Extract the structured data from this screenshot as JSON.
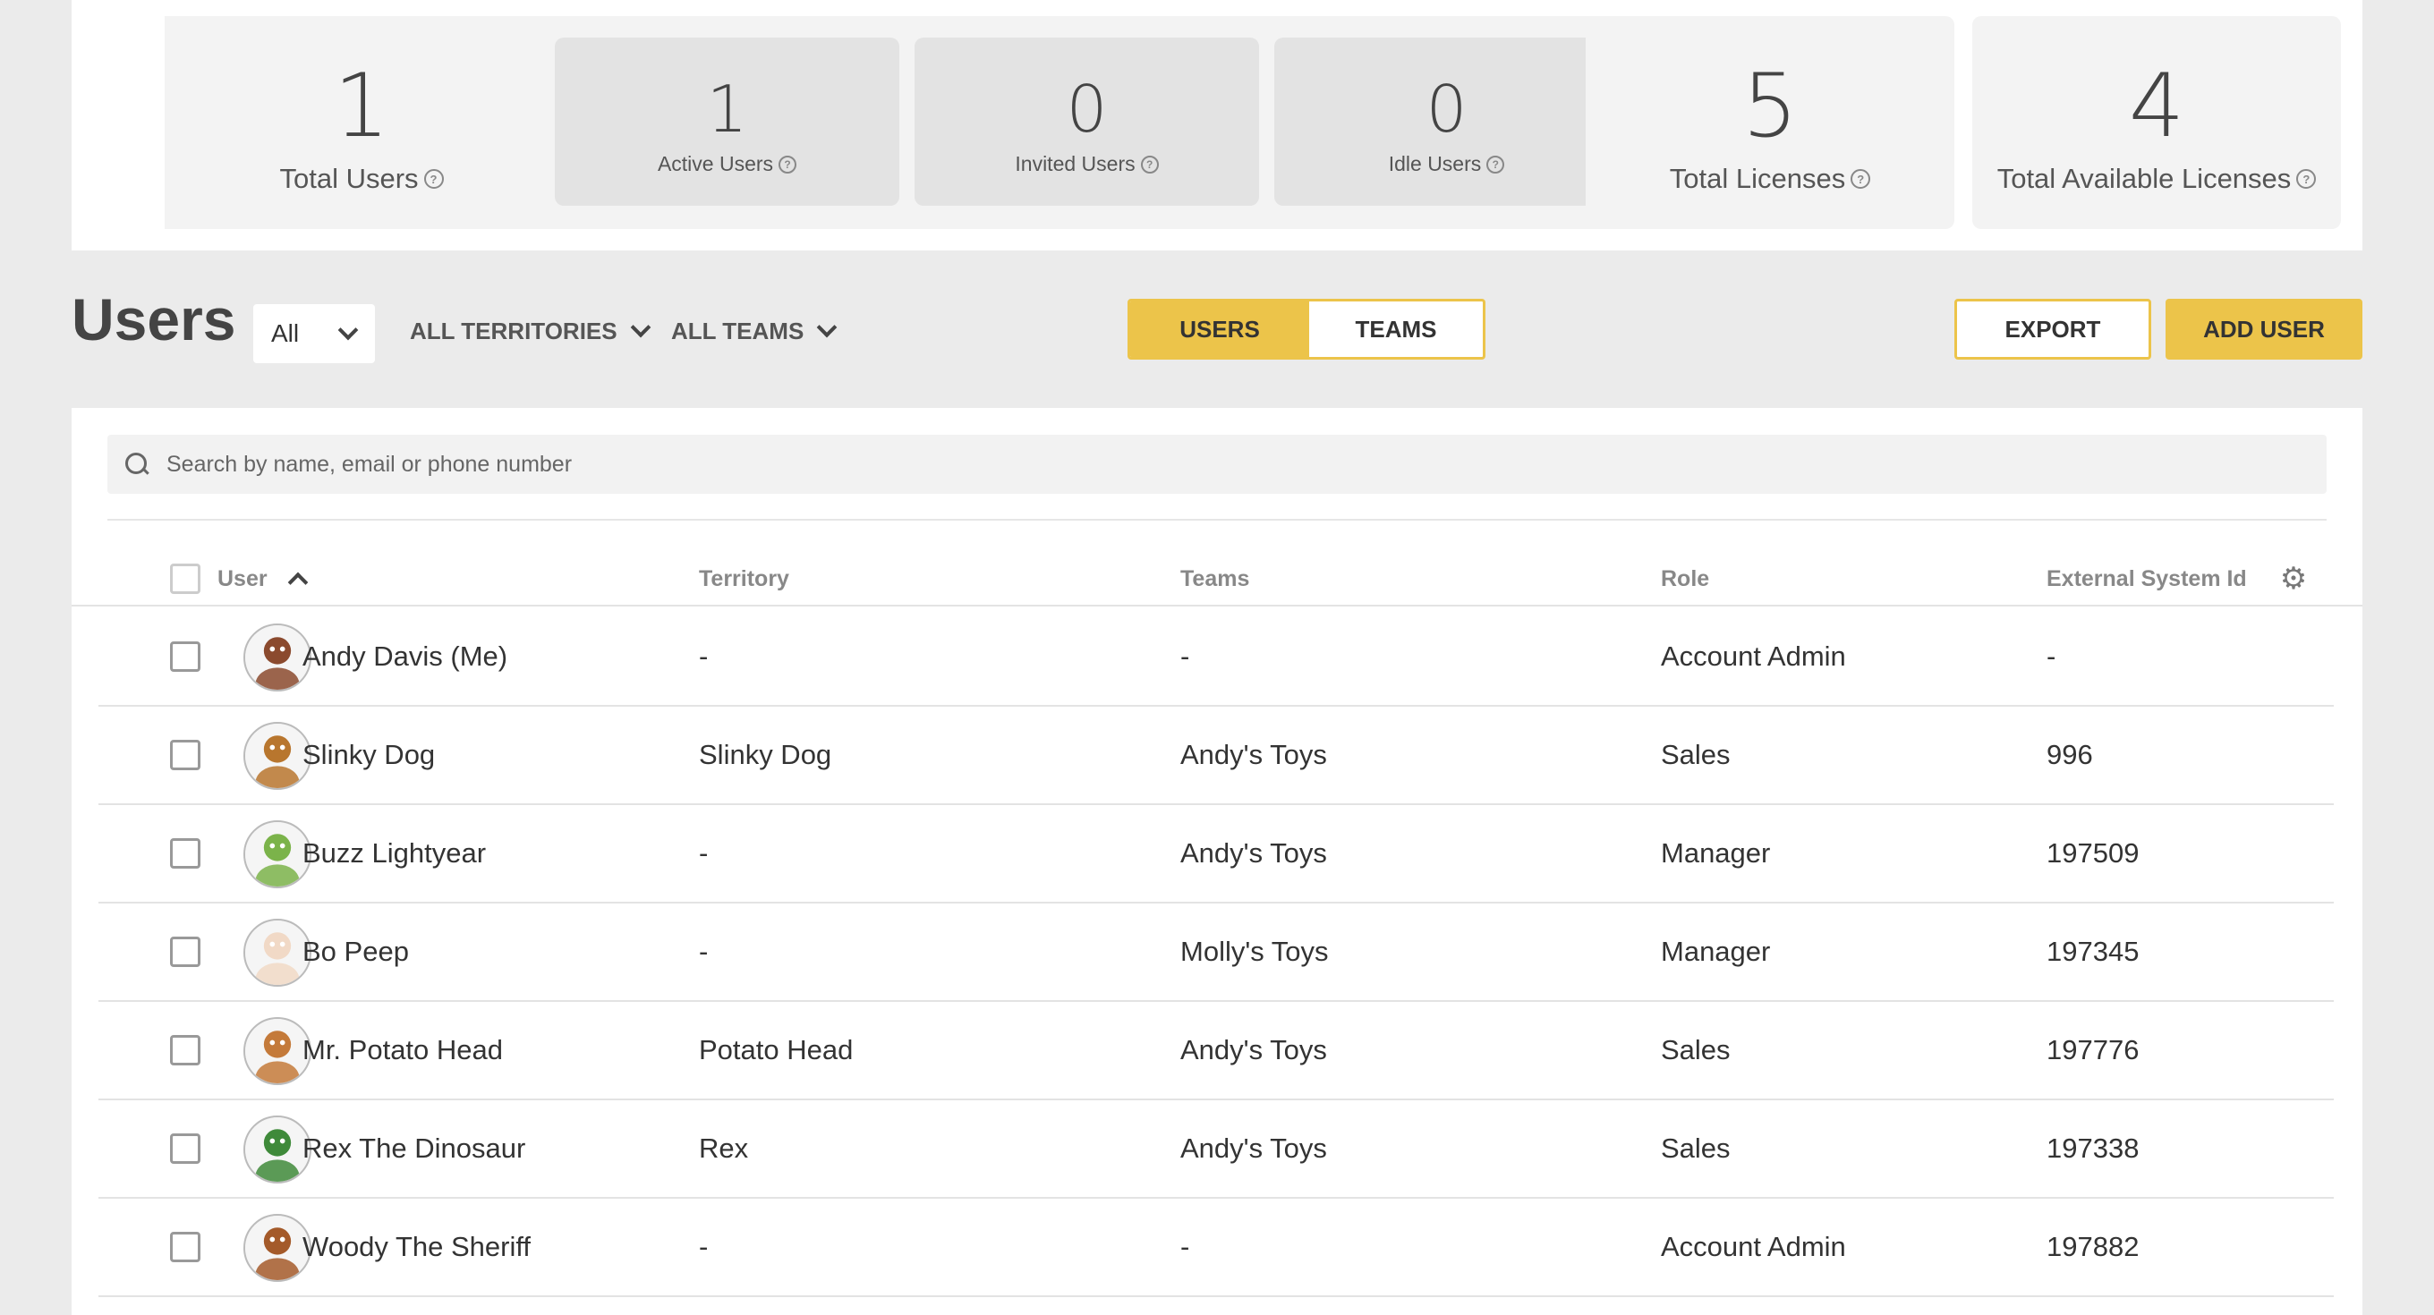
{
  "stats": {
    "total_users": {
      "value": "1",
      "label": "Total Users"
    },
    "active_users": {
      "value": "1",
      "label": "Active Users"
    },
    "invited_users": {
      "value": "0",
      "label": "Invited Users"
    },
    "idle_users": {
      "value": "0",
      "label": "Idle Users"
    },
    "total_licenses": {
      "value": "5",
      "label": "Total Licenses"
    },
    "total_available_licenses": {
      "value": "4",
      "label": "Total Available Licenses"
    },
    "help_glyph": "?"
  },
  "toolbar": {
    "title": "Users",
    "status_filter": "All",
    "territories_filter": "ALL TERRITORIES",
    "teams_filter": "ALL TEAMS",
    "view_toggle": {
      "users": "USERS",
      "teams": "TEAMS",
      "active": "users"
    },
    "export_label": "EXPORT",
    "add_user_label": "ADD USER"
  },
  "search": {
    "placeholder": "Search by name, email or phone number",
    "value": ""
  },
  "table": {
    "columns": {
      "user": "User",
      "territory": "Territory",
      "teams": "Teams",
      "role": "Role",
      "external_id": "External System Id"
    },
    "sort": {
      "column": "user",
      "direction": "ascending"
    },
    "rows": [
      {
        "user": "Andy Davis (Me)",
        "territory": "-",
        "teams": "-",
        "role": "Account Admin",
        "external_id": "-",
        "avatar": "andy-avatar",
        "avatar_color": "#8b4a2e"
      },
      {
        "user": "Slinky Dog",
        "territory": "Slinky Dog",
        "teams": "Andy's Toys",
        "role": "Sales",
        "external_id": "996",
        "avatar": "slinky-avatar",
        "avatar_color": "#b8762e"
      },
      {
        "user": "Buzz Lightyear",
        "territory": "-",
        "teams": "Andy's Toys",
        "role": "Manager",
        "external_id": "197509",
        "avatar": "buzz-avatar",
        "avatar_color": "#7bb34a"
      },
      {
        "user": "Bo Peep",
        "territory": "-",
        "teams": "Molly's Toys",
        "role": "Manager",
        "external_id": "197345",
        "avatar": "bopeep-avatar",
        "avatar_color": "#f1d9c6"
      },
      {
        "user": "Mr. Potato Head",
        "territory": "Potato Head",
        "teams": "Andy's Toys",
        "role": "Sales",
        "external_id": "197776",
        "avatar": "potato-avatar",
        "avatar_color": "#c47a3a"
      },
      {
        "user": "Rex The Dinosaur",
        "territory": "Rex",
        "teams": "Andy's Toys",
        "role": "Sales",
        "external_id": "197338",
        "avatar": "rex-avatar",
        "avatar_color": "#3f8a3a"
      },
      {
        "user": "Woody The Sheriff",
        "territory": "-",
        "teams": "-",
        "role": "Account Admin",
        "external_id": "197882",
        "avatar": "woody-avatar",
        "avatar_color": "#a45a2a"
      }
    ]
  },
  "colors": {
    "accent": "#ecc44a",
    "background": "#ebebeb",
    "panel": "#ffffff"
  }
}
